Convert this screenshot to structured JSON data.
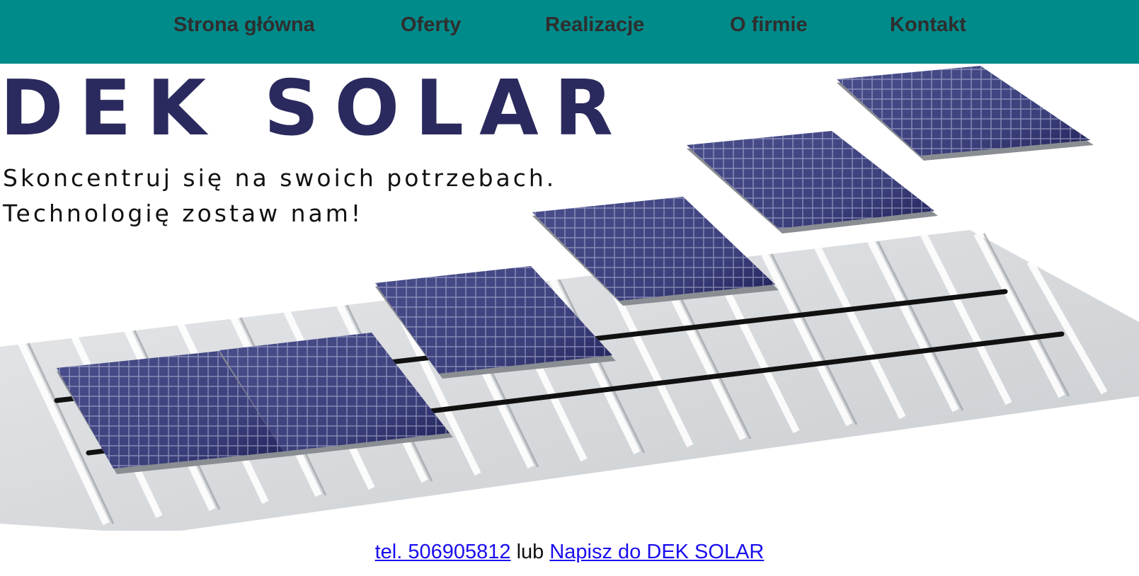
{
  "nav": {
    "items": [
      {
        "label": "Strona główna"
      },
      {
        "label": "Oferty"
      },
      {
        "label": "Realizacje"
      },
      {
        "label": "O firmie"
      },
      {
        "label": "Kontakt"
      }
    ],
    "background": "#008b8b"
  },
  "hero": {
    "brand": "DEK SOLAR",
    "tagline_line1": "Skoncentruj się na swoich potrzebach.",
    "tagline_line2": "Technologię zostaw nam!",
    "image": "solar-panels-on-metal-roof-illustration"
  },
  "contact": {
    "phone_link": "tel. 506905812",
    "separator": "lub",
    "email_link": "Napisz do DEK SOLAR"
  }
}
